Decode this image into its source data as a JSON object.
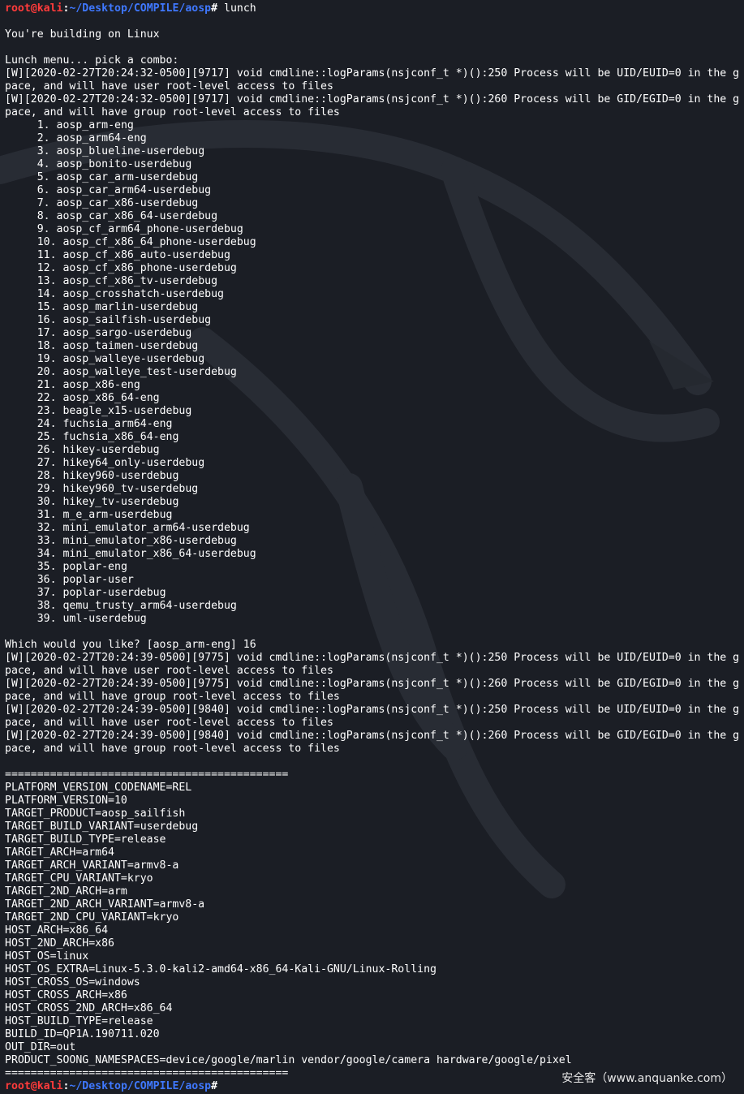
{
  "prompt": {
    "user_host": "root@kali",
    "path": "~/Desktop/COMPILE/aosp",
    "symbol": "#"
  },
  "first_command": "lunch",
  "building_msg": "You're building on Linux",
  "menu_header": "Lunch menu... pick a combo:",
  "log_first": [
    "[W][2020-02-27T20:24:32-0500][9717] void cmdline::logParams(nsjconf_t *)():250 Process will be UID/EUID=0 in the g",
    "pace, and will have user root-level access to files",
    "[W][2020-02-27T20:24:32-0500][9717] void cmdline::logParams(nsjconf_t *)():260 Process will be GID/EGID=0 in the g",
    "pace, and will have group root-level access to files"
  ],
  "combos": [
    {
      "num": "1.",
      "name": "aosp_arm-eng"
    },
    {
      "num": "2.",
      "name": "aosp_arm64-eng"
    },
    {
      "num": "3.",
      "name": "aosp_blueline-userdebug"
    },
    {
      "num": "4.",
      "name": "aosp_bonito-userdebug"
    },
    {
      "num": "5.",
      "name": "aosp_car_arm-userdebug"
    },
    {
      "num": "6.",
      "name": "aosp_car_arm64-userdebug"
    },
    {
      "num": "7.",
      "name": "aosp_car_x86-userdebug"
    },
    {
      "num": "8.",
      "name": "aosp_car_x86_64-userdebug"
    },
    {
      "num": "9.",
      "name": "aosp_cf_arm64_phone-userdebug"
    },
    {
      "num": "10.",
      "name": "aosp_cf_x86_64_phone-userdebug"
    },
    {
      "num": "11.",
      "name": "aosp_cf_x86_auto-userdebug"
    },
    {
      "num": "12.",
      "name": "aosp_cf_x86_phone-userdebug"
    },
    {
      "num": "13.",
      "name": "aosp_cf_x86_tv-userdebug"
    },
    {
      "num": "14.",
      "name": "aosp_crosshatch-userdebug"
    },
    {
      "num": "15.",
      "name": "aosp_marlin-userdebug"
    },
    {
      "num": "16.",
      "name": "aosp_sailfish-userdebug"
    },
    {
      "num": "17.",
      "name": "aosp_sargo-userdebug"
    },
    {
      "num": "18.",
      "name": "aosp_taimen-userdebug"
    },
    {
      "num": "19.",
      "name": "aosp_walleye-userdebug"
    },
    {
      "num": "20.",
      "name": "aosp_walleye_test-userdebug"
    },
    {
      "num": "21.",
      "name": "aosp_x86-eng"
    },
    {
      "num": "22.",
      "name": "aosp_x86_64-eng"
    },
    {
      "num": "23.",
      "name": "beagle_x15-userdebug"
    },
    {
      "num": "24.",
      "name": "fuchsia_arm64-eng"
    },
    {
      "num": "25.",
      "name": "fuchsia_x86_64-eng"
    },
    {
      "num": "26.",
      "name": "hikey-userdebug"
    },
    {
      "num": "27.",
      "name": "hikey64_only-userdebug"
    },
    {
      "num": "28.",
      "name": "hikey960-userdebug"
    },
    {
      "num": "29.",
      "name": "hikey960_tv-userdebug"
    },
    {
      "num": "30.",
      "name": "hikey_tv-userdebug"
    },
    {
      "num": "31.",
      "name": "m_e_arm-userdebug"
    },
    {
      "num": "32.",
      "name": "mini_emulator_arm64-userdebug"
    },
    {
      "num": "33.",
      "name": "mini_emulator_x86-userdebug"
    },
    {
      "num": "34.",
      "name": "mini_emulator_x86_64-userdebug"
    },
    {
      "num": "35.",
      "name": "poplar-eng"
    },
    {
      "num": "36.",
      "name": "poplar-user"
    },
    {
      "num": "37.",
      "name": "poplar-userdebug"
    },
    {
      "num": "38.",
      "name": "qemu_trusty_arm64-userdebug"
    },
    {
      "num": "39.",
      "name": "uml-userdebug"
    }
  ],
  "choice_prompt": "Which would you like? [aosp_arm-eng] 16",
  "log_second": [
    "[W][2020-02-27T20:24:39-0500][9775] void cmdline::logParams(nsjconf_t *)():250 Process will be UID/EUID=0 in the g",
    "pace, and will have user root-level access to files",
    "[W][2020-02-27T20:24:39-0500][9775] void cmdline::logParams(nsjconf_t *)():260 Process will be GID/EGID=0 in the g",
    "pace, and will have group root-level access to files",
    "[W][2020-02-27T20:24:39-0500][9840] void cmdline::logParams(nsjconf_t *)():250 Process will be UID/EUID=0 in the g",
    "pace, and will have user root-level access to files",
    "[W][2020-02-27T20:24:39-0500][9840] void cmdline::logParams(nsjconf_t *)():260 Process will be GID/EGID=0 in the g",
    "pace, and will have group root-level access to files"
  ],
  "separator": "============================================",
  "env_vars": [
    "PLATFORM_VERSION_CODENAME=REL",
    "PLATFORM_VERSION=10",
    "TARGET_PRODUCT=aosp_sailfish",
    "TARGET_BUILD_VARIANT=userdebug",
    "TARGET_BUILD_TYPE=release",
    "TARGET_ARCH=arm64",
    "TARGET_ARCH_VARIANT=armv8-a",
    "TARGET_CPU_VARIANT=kryo",
    "TARGET_2ND_ARCH=arm",
    "TARGET_2ND_ARCH_VARIANT=armv8-a",
    "TARGET_2ND_CPU_VARIANT=kryo",
    "HOST_ARCH=x86_64",
    "HOST_2ND_ARCH=x86",
    "HOST_OS=linux",
    "HOST_OS_EXTRA=Linux-5.3.0-kali2-amd64-x86_64-Kali-GNU/Linux-Rolling",
    "HOST_CROSS_OS=windows",
    "HOST_CROSS_ARCH=x86",
    "HOST_CROSS_2ND_ARCH=x86_64",
    "HOST_BUILD_TYPE=release",
    "BUILD_ID=QP1A.190711.020",
    "OUT_DIR=out",
    "PRODUCT_SOONG_NAMESPACES=device/google/marlin vendor/google/camera hardware/google/pixel"
  ],
  "watermark": "安全客（www.anquanke.com）",
  "colors": {
    "background": "#1b1e25",
    "prompt_user": "#ff3b3b",
    "prompt_path": "#3f78ff",
    "text": "#ffffff"
  }
}
